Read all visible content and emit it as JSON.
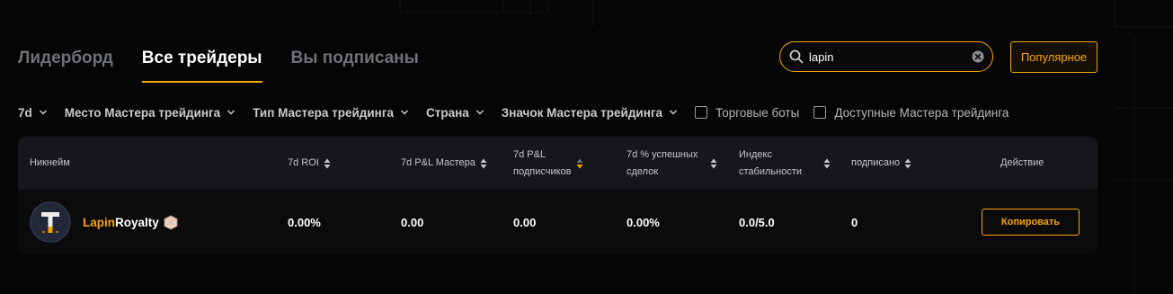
{
  "tabs": [
    {
      "label": "Лидерборд"
    },
    {
      "label": "Все трейдеры"
    },
    {
      "label": "Вы подписаны"
    }
  ],
  "search": {
    "value": "lapin"
  },
  "popular_label": "Популярное",
  "filters": {
    "period": "7d",
    "master_place": "Место Мастера трейдинга",
    "master_type": "Тип Мастера трейдинга",
    "country": "Страна",
    "master_badge": "Значок Мастера трейдинга",
    "trading_bots": "Торговые боты",
    "available_masters": "Доступные Мастера трейдинга"
  },
  "table": {
    "headers": {
      "nickname": "Никнейм",
      "roi": "7d ROI",
      "master_pnl": "7d P&L Мастера",
      "subs_pnl_1": "7d P&L",
      "subs_pnl_2": "подписчиков",
      "win_rate_1": "7d % успешных",
      "win_rate_2": "сделок",
      "stability_1": "Индекс",
      "stability_2": "стабильности",
      "subscribed": "подписано",
      "action": "Действие"
    },
    "rows": [
      {
        "nick_highlight": "Lapin",
        "nick_rest": "Royalty",
        "avatar_letter": "T",
        "roi": "0.00%",
        "master_pnl": "0.00",
        "subs_pnl": "0.00",
        "win_rate": "0.00%",
        "stability": "0.0/5.0",
        "subscribed": "0",
        "action": "Копировать"
      }
    ]
  },
  "colors": {
    "accent": "#f7a600",
    "background": "#050505",
    "header_bg": "#16171a"
  },
  "icons": [
    "search-icon",
    "clear-icon",
    "chevron-down-icon",
    "sort-icon",
    "avatar-icon",
    "badge-icon"
  ]
}
